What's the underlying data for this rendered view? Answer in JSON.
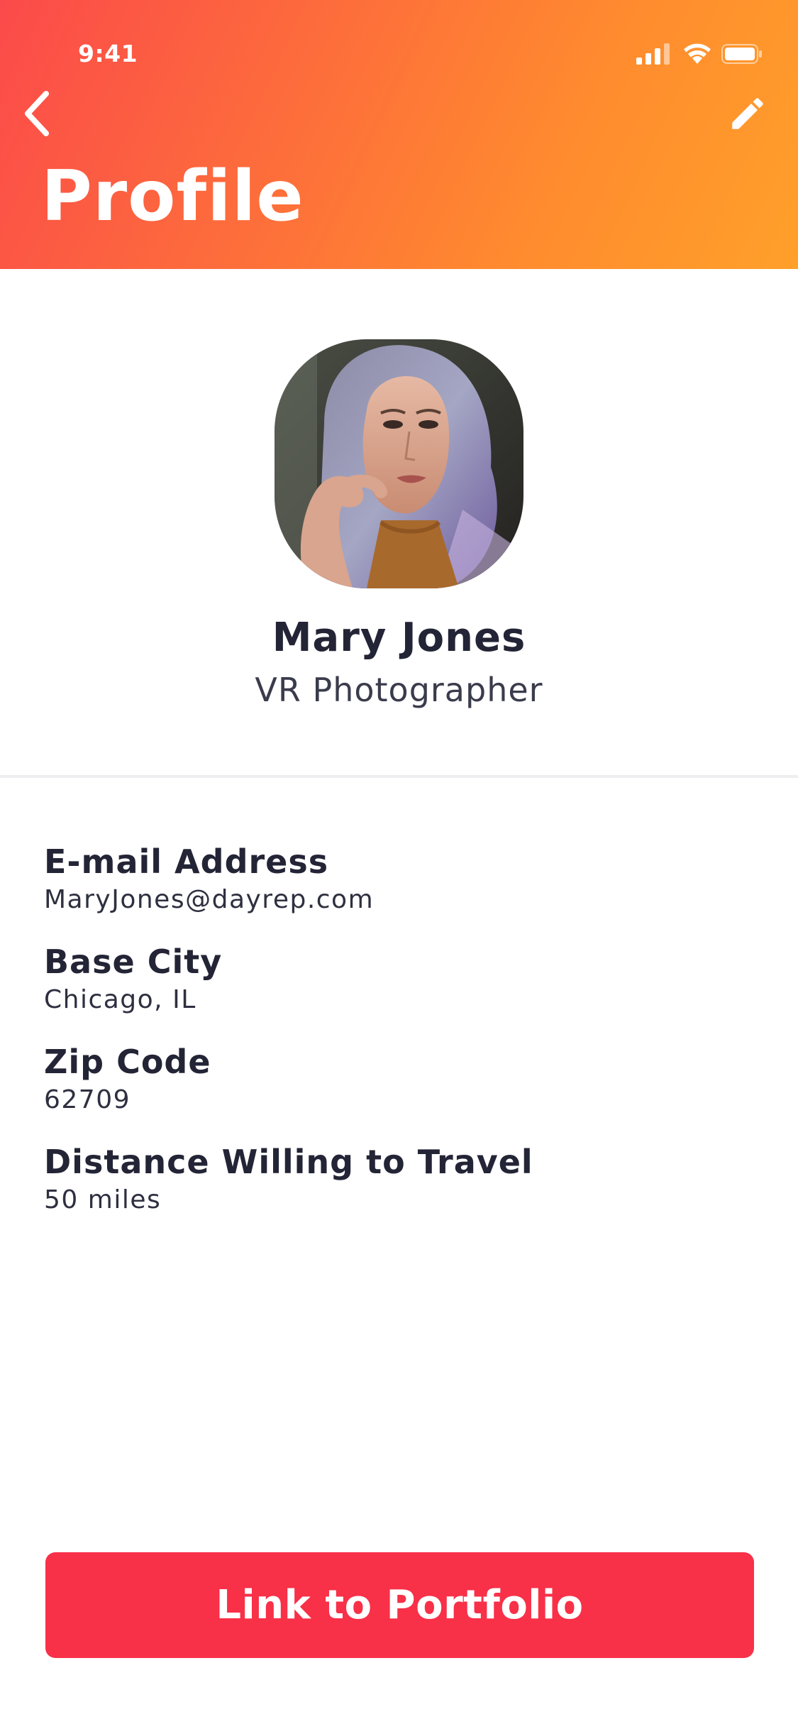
{
  "status_bar": {
    "time": "9:41",
    "icons": [
      "cellular-signal-icon",
      "wifi-icon",
      "battery-icon"
    ]
  },
  "header": {
    "title": "Profile",
    "back_icon": "chevron-left-icon",
    "edit_icon": "pencil-icon",
    "gradient_colors": [
      "#fb4a4a",
      "#ffa02a"
    ]
  },
  "profile": {
    "avatar_description": "portrait photo",
    "name": "Mary Jones",
    "job_title": "VR Photographer"
  },
  "details": [
    {
      "label": "E-mail Address",
      "value": "MaryJones@dayrep.com"
    },
    {
      "label": "Base City",
      "value": "Chicago, IL"
    },
    {
      "label": "Zip Code",
      "value": "62709"
    },
    {
      "label": "Distance Willing to Travel",
      "value": "50 miles"
    }
  ],
  "actions": {
    "portfolio_button": "Link to Portfolio",
    "button_color": "#f83048"
  }
}
